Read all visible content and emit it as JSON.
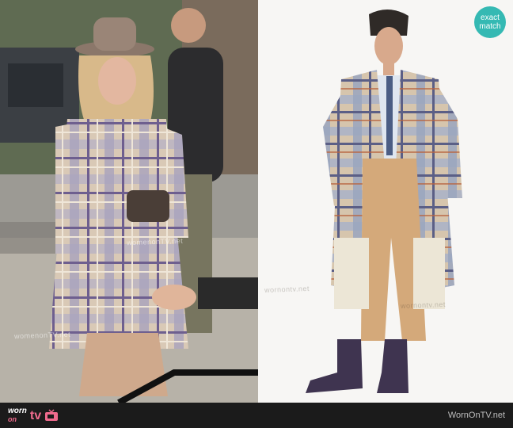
{
  "badge": {
    "line1": "exact",
    "line2": "match"
  },
  "watermarks": {
    "left": "womenonTV.net",
    "right": "wornontv.net"
  },
  "footer": {
    "logo_worn": "worn",
    "logo_on": "on",
    "logo_tv": "tv",
    "site": "WornOnTV.net"
  },
  "colors": {
    "badge": "#35b9b3",
    "footer_bg": "#1b1b1b",
    "logo_accent": "#f06b8e"
  }
}
